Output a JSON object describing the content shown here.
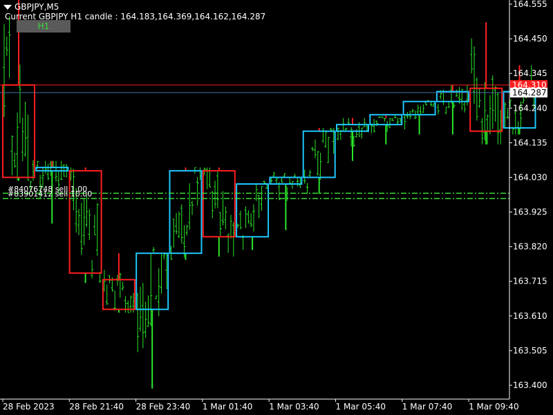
{
  "header": {
    "symbol": "GBPJPY,M5",
    "candle_info": "Current GBPJPY H1 candle : 164.183,164.369,164.162,164.287",
    "timeframe_button": "H1"
  },
  "colors": {
    "background": "#000000",
    "axis": "#ffffff",
    "bull_box": "#1ec8ff",
    "bear_box": "#ff1e1e",
    "wick_bull": "#2ae82a",
    "wick_bear": "#ff2020",
    "bid_line": "#4a6fa0",
    "order_line": "#3cdc3c",
    "h1_line": "#ff1e1e",
    "price_label_bid": "#ffffff",
    "price_label_h1": "#ff1e1e"
  },
  "orders": [
    {
      "label": "#84076748 sell 1.00",
      "price": 163.982
    },
    {
      "label": "#83901412 sell 10.00",
      "price": 163.966
    }
  ],
  "chart_data": {
    "type": "candlestick",
    "y_axis_ticks": [
      "164.555",
      "164.450",
      "164.345",
      "164.240",
      "164.135",
      "164.030",
      "163.925",
      "163.820",
      "163.715",
      "163.610",
      "163.505",
      "163.400"
    ],
    "x_axis_ticks": [
      "28 Feb 2023",
      "28 Feb 21:40",
      "28 Feb 23:40",
      "1 Mar 01:40",
      "1 Mar 03:40",
      "1 Mar 05:40",
      "1 Mar 07:40",
      "1 Mar 09:40"
    ],
    "ylim": [
      163.37,
      164.56
    ],
    "h1_candles": [
      {
        "open": 164.31,
        "high": 164.66,
        "low": 164.02,
        "close": 164.03
      },
      {
        "open": 164.05,
        "high": 164.08,
        "low": 163.89,
        "close": 164.06
      },
      {
        "open": 164.05,
        "high": 164.06,
        "low": 163.71,
        "close": 163.74
      },
      {
        "open": 163.72,
        "high": 163.8,
        "low": 163.62,
        "close": 163.63
      },
      {
        "open": 163.63,
        "high": 163.8,
        "low": 163.39,
        "close": 163.8
      },
      {
        "open": 163.8,
        "high": 164.06,
        "low": 163.78,
        "close": 164.05
      },
      {
        "open": 164.05,
        "high": 164.06,
        "low": 163.79,
        "close": 163.85
      },
      {
        "open": 163.85,
        "high": 164.01,
        "low": 163.81,
        "close": 164.01
      },
      {
        "open": 164.01,
        "high": 164.03,
        "low": 163.87,
        "close": 164.03
      },
      {
        "open": 164.03,
        "high": 164.18,
        "low": 163.98,
        "close": 164.17
      },
      {
        "open": 164.17,
        "high": 164.21,
        "low": 164.08,
        "close": 164.19
      },
      {
        "open": 164.19,
        "high": 164.21,
        "low": 164.13,
        "close": 164.22
      },
      {
        "open": 164.22,
        "high": 164.26,
        "low": 164.16,
        "close": 164.26
      },
      {
        "open": 164.26,
        "high": 164.31,
        "low": 164.16,
        "close": 164.29
      },
      {
        "open": 164.3,
        "high": 164.5,
        "low": 164.13,
        "close": 164.17
      },
      {
        "open": 164.18,
        "high": 164.37,
        "low": 164.16,
        "close": 164.29
      }
    ],
    "price_labels": {
      "bid": "164.287",
      "h1_open": "164.310"
    },
    "bid_price": 164.287,
    "h1_open_price": 164.31
  }
}
